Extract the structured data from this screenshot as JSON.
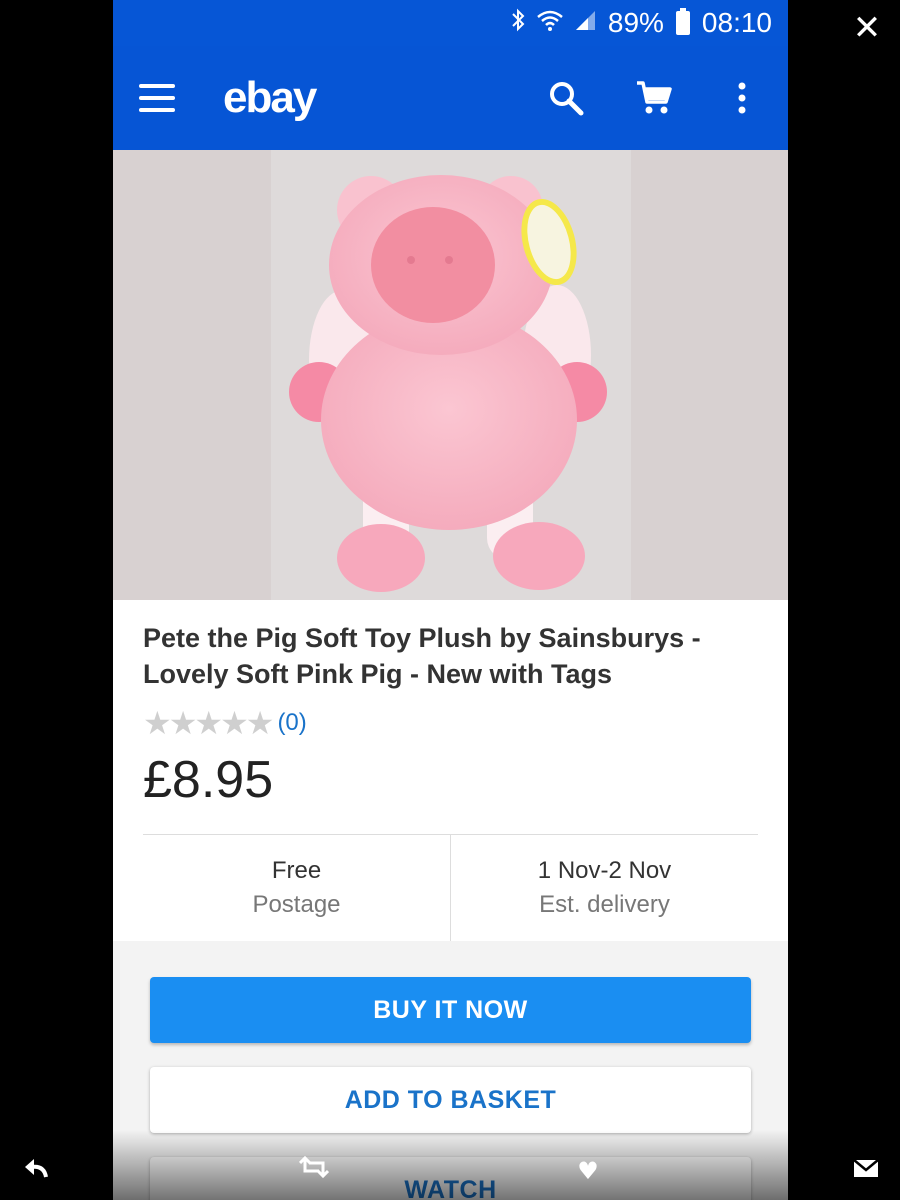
{
  "status_bar": {
    "battery": "89%",
    "time": "08:10"
  },
  "app_bar": {
    "logo": "ebay"
  },
  "product": {
    "title": "Pete the Pig Soft Toy Plush by Sainsburys - Lovely Soft Pink Pig - New with Tags",
    "rating": 0,
    "review_count": "(0)",
    "price": "£8.95",
    "tag_text": "pete the pig"
  },
  "info": {
    "postage_value": "Free",
    "postage_label": "Postage",
    "delivery_value": "1 Nov-2 Nov",
    "delivery_label": "Est. delivery"
  },
  "actions": {
    "buy_now": "BUY IT NOW",
    "add_to_basket": "ADD TO BASKET",
    "watch": "WATCH"
  },
  "colors": {
    "brand_blue": "#0655d5",
    "button_blue": "#1a8ef2",
    "link_blue": "#1a73c9"
  },
  "icons": [
    "close-icon",
    "reply-icon",
    "retweet-icon",
    "heart-icon",
    "message-icon",
    "bluetooth-icon",
    "wifi-icon",
    "signal-icon",
    "battery-icon",
    "menu-icon",
    "search-icon",
    "cart-icon",
    "more-vert-icon"
  ]
}
